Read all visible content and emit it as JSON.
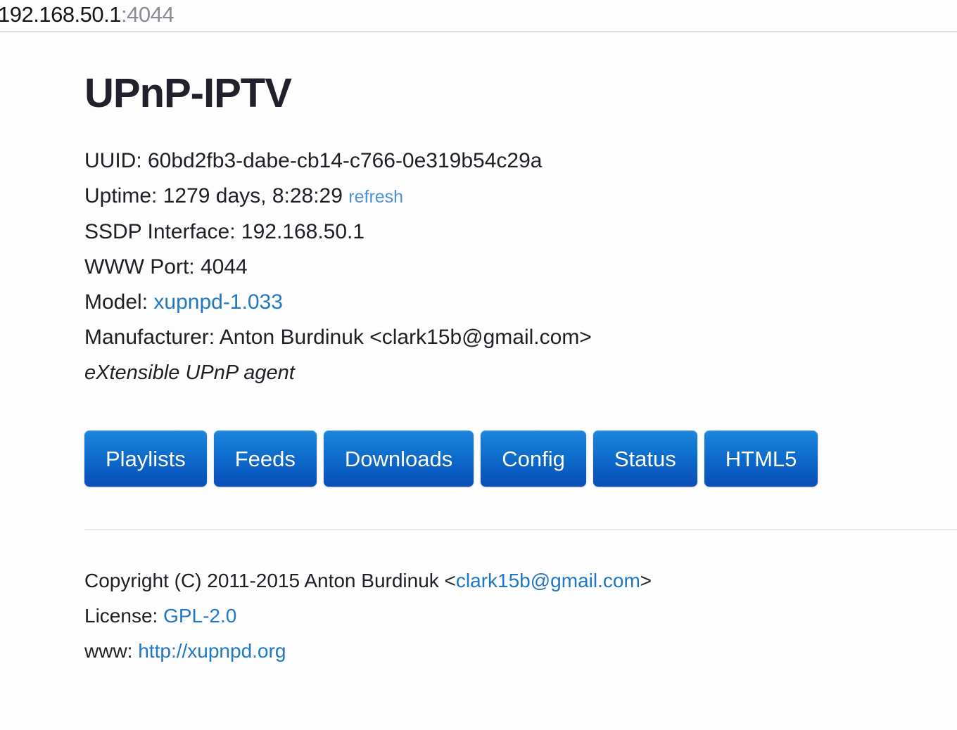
{
  "browser": {
    "address_host": "192.168.50.1",
    "address_port": ":4044"
  },
  "page": {
    "title": "UPnP-IPTV",
    "info": {
      "uuid_label": "UUID: ",
      "uuid_value": "60bd2fb3-dabe-cb14-c766-0e319b54c29a",
      "uptime_label": "Uptime: ",
      "uptime_value": "1279 days, 8:28:29",
      "refresh_link": "refresh",
      "ssdp_label": "SSDP Interface: ",
      "ssdp_value": "192.168.50.1",
      "www_label": "WWW Port: ",
      "www_value": "4044",
      "model_label": "Model: ",
      "model_link": "xupnpd-1.033",
      "manufacturer_label": "Manufacturer: ",
      "manufacturer_value": "Anton Burdinuk <clark15b@gmail.com>",
      "tagline": "eXtensible UPnP agent"
    },
    "buttons": [
      {
        "label": "Playlists",
        "name": "playlists"
      },
      {
        "label": "Feeds",
        "name": "feeds"
      },
      {
        "label": "Downloads",
        "name": "downloads"
      },
      {
        "label": "Config",
        "name": "config"
      },
      {
        "label": "Status",
        "name": "status"
      },
      {
        "label": "HTML5",
        "name": "html5"
      }
    ],
    "footer": {
      "copyright_prefix": "Copyright (C) 2011-2015 Anton Burdinuk <",
      "copyright_email": "clark15b@gmail.com",
      "copyright_suffix": ">",
      "license_label": "License: ",
      "license_link": "GPL-2.0",
      "www_label": "www: ",
      "www_link": "http://xupnpd.org"
    }
  },
  "colors": {
    "link": "#2077c4",
    "link_light": "#4c92d6",
    "button_top": "#1d86dc",
    "button_bottom": "#0b4fb6",
    "page_bg": "#fdfdfd",
    "text": "#1f1f26"
  }
}
